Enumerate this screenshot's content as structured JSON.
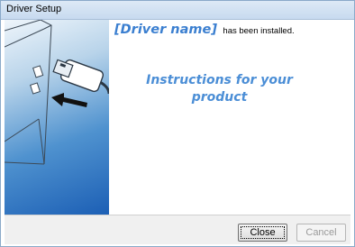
{
  "window": {
    "title": "Driver Setup"
  },
  "content": {
    "driver_name": "[Driver name]",
    "installed_text": "has been installed.",
    "instructions_line1": "Instructions for your",
    "instructions_line2": "product"
  },
  "buttons": {
    "close": "Close",
    "cancel": "Cancel"
  },
  "illustration": {
    "depicts": [
      "laptop-icon",
      "usb-cable-icon",
      "arrow-left-icon"
    ]
  },
  "colors": {
    "accent_text": "#3b7fd0",
    "panel_gradient_top": "#eef5fb",
    "panel_gradient_bottom": "#1c5fb5",
    "titlebar": "#c7daef"
  }
}
